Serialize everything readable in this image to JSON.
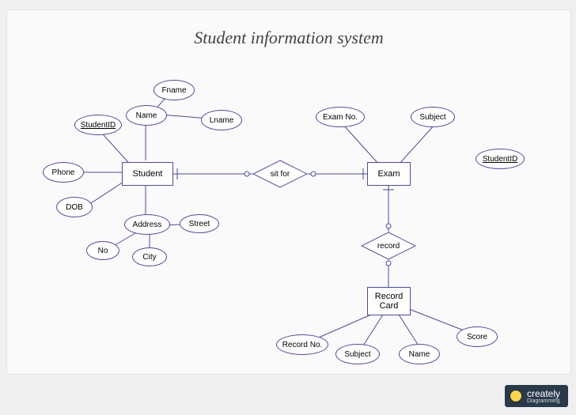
{
  "title": "Student information system",
  "entities": {
    "student": "Student",
    "exam": "Exam",
    "record_card": "Record\nCard"
  },
  "relationships": {
    "sit_for": "sit for",
    "record": "record"
  },
  "attributes": {
    "student": {
      "student_id": "StudentID",
      "name": "Name",
      "fname": "Fname",
      "lname": "Lname",
      "phone": "Phone",
      "dob": "DOB",
      "address": "Address",
      "address_no": "No",
      "address_city": "City",
      "address_street": "Street"
    },
    "exam": {
      "exam_no": "Exam No.",
      "subject": "Subject",
      "student_id": "StudentID"
    },
    "record_card": {
      "record_no": "Record No.",
      "subject": "Subject",
      "name": "Name",
      "score": "Score"
    }
  },
  "watermark": {
    "brand": "creately",
    "tagline": "Diagramming"
  },
  "chart_data": {
    "type": "er-diagram",
    "entities": [
      {
        "name": "Student",
        "attributes": [
          {
            "name": "StudentID",
            "key": true
          },
          {
            "name": "Name",
            "composite_of": [
              "Fname",
              "Lname"
            ]
          },
          {
            "name": "Phone"
          },
          {
            "name": "DOB"
          },
          {
            "name": "Address",
            "composite_of": [
              "No",
              "City",
              "Street"
            ]
          }
        ]
      },
      {
        "name": "Exam",
        "attributes": [
          {
            "name": "Exam No."
          },
          {
            "name": "Subject"
          },
          {
            "name": "StudentID",
            "key": true
          }
        ]
      },
      {
        "name": "Record Card",
        "attributes": [
          {
            "name": "Record No."
          },
          {
            "name": "Subject"
          },
          {
            "name": "Name"
          },
          {
            "name": "Score"
          }
        ]
      }
    ],
    "relationships": [
      {
        "name": "sit for",
        "between": [
          "Student",
          "Exam"
        ]
      },
      {
        "name": "record",
        "between": [
          "Exam",
          "Record Card"
        ]
      }
    ]
  }
}
